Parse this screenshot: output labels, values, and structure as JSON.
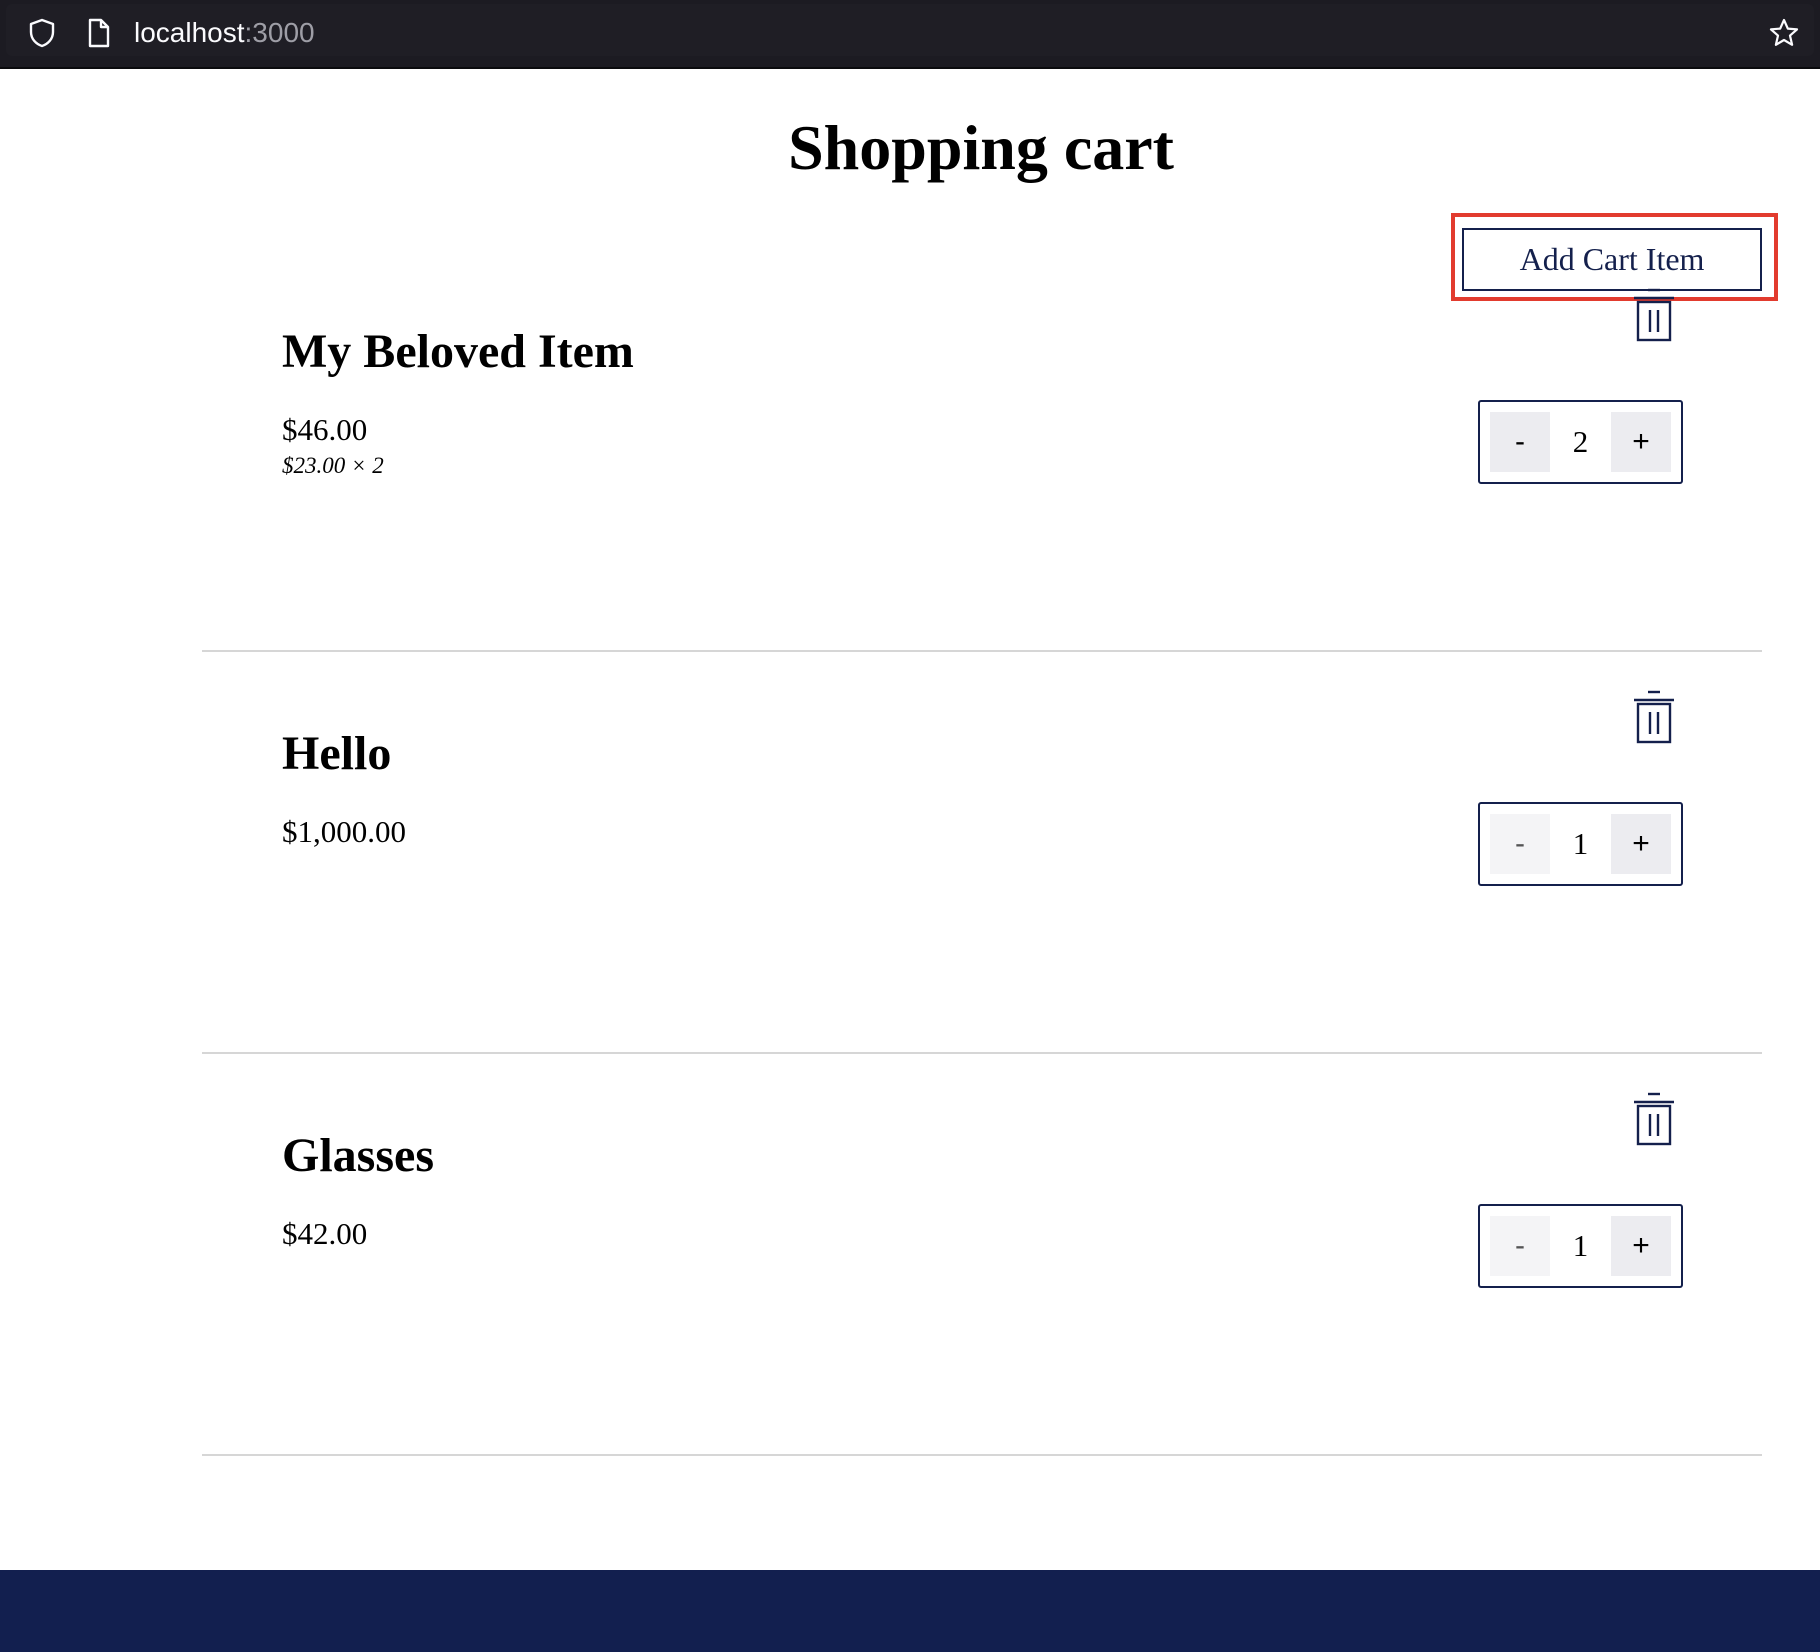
{
  "browser": {
    "url_host": "localhost",
    "url_port": ":3000",
    "icons": [
      "shield-icon",
      "page-icon",
      "star-icon"
    ]
  },
  "page": {
    "title": "Shopping cart",
    "add_button_label": "Add Cart Item"
  },
  "cart": {
    "items": [
      {
        "name": "My Beloved Item",
        "total": "$46.00",
        "breakdown": "$23.00 × 2",
        "minus": "-",
        "quantity": "2",
        "plus": "+"
      },
      {
        "name": "Hello",
        "total": "$1,000.00",
        "breakdown": "",
        "minus": "-",
        "quantity": "1",
        "plus": "+"
      },
      {
        "name": "Glasses",
        "total": "$42.00",
        "breakdown": "",
        "minus": "-",
        "quantity": "1",
        "plus": "+"
      }
    ]
  },
  "colors": {
    "browser_bar": "#1c1b22",
    "accent_navy": "#14204c",
    "footer": "#121f4f",
    "highlight": "#e23b2e",
    "stepper_button": "#ececf0",
    "divider": "#d6d6d6"
  }
}
